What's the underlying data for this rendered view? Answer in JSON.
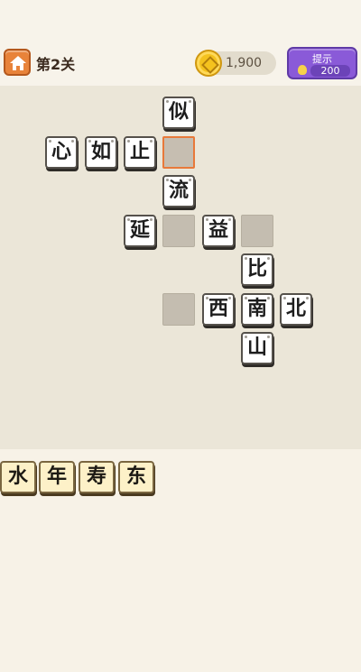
{
  "header": {
    "level_label": "第2关",
    "coins": "1,900",
    "hint_label": "提示",
    "hint_cost": "200"
  },
  "board": {
    "tiles": {
      "si": "似",
      "xin": "心",
      "ru": "如",
      "zhi": "止",
      "liu": "流",
      "yan": "延",
      "yi": "益",
      "bi": "比",
      "xi": "西",
      "nan": "南",
      "bei": "北",
      "shan": "山"
    }
  },
  "options": [
    "水",
    "年",
    "寿",
    "东"
  ],
  "colors": {
    "accent": "#e8793a",
    "hint_purple": "#8a5ad8",
    "coin_gold": "#f4c21e",
    "option_bg": "#fdf1c8"
  },
  "icons": {
    "home": "home-icon",
    "coin": "coin-icon",
    "hint": "lightbulb-icon"
  }
}
